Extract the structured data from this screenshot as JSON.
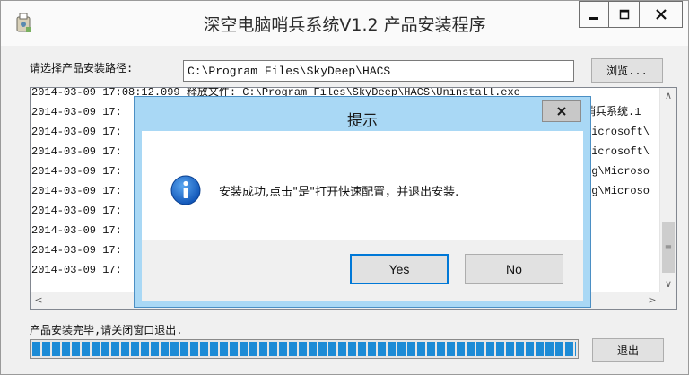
{
  "window": {
    "title": "深空电脑哨兵系统V1.2 产品安装程序",
    "minimize_glyph": "–",
    "maximize_glyph": "□",
    "close_glyph": "X",
    "icon": "installer-app-icon"
  },
  "install": {
    "path_label": "请选择产品安装路径:",
    "path_value": "C:\\Program Files\\SkyDeep\\HACS",
    "browse_label": "浏览..."
  },
  "log": {
    "lines": [
      "2014-03-09 17:08:12.099 释放文件: C:\\Program Files\\SkyDeep\\HACS\\Uninstall.exe",
      "2014-03-09 17:",
      "2014-03-09 17:",
      "2014-03-09 17:",
      "2014-03-09 17:",
      "2014-03-09 17:",
      "2014-03-09 17:",
      "2014-03-09 17:",
      "2014-03-09 17:",
      "2014-03-09 17:"
    ],
    "right_fragments": [
      "",
      "哨兵系统.1",
      "Microsoft\\",
      "Microsoft\\",
      "ng\\Microso",
      "ng\\Microso",
      "",
      "",
      "",
      ""
    ],
    "scroll_up": "∧",
    "scroll_down": "∨",
    "scroll_left": "<",
    "scroll_right": ">",
    "thumb_grip": "≡"
  },
  "status": {
    "text": "产品安装完毕,请关闭窗口退出.",
    "progress": 1.0,
    "exit_label": "退出"
  },
  "dialog": {
    "title": "提示",
    "close_glyph": "x",
    "message": "安装成功,点击\"是\"打开快速配置，并退出安装.",
    "icon": "info-icon",
    "yes_label": "Yes",
    "no_label": "No"
  },
  "colors": {
    "dialog_frame": "#a9d8f5",
    "progress_fill": "#1c8bd6",
    "default_button_border": "#0078d7"
  }
}
